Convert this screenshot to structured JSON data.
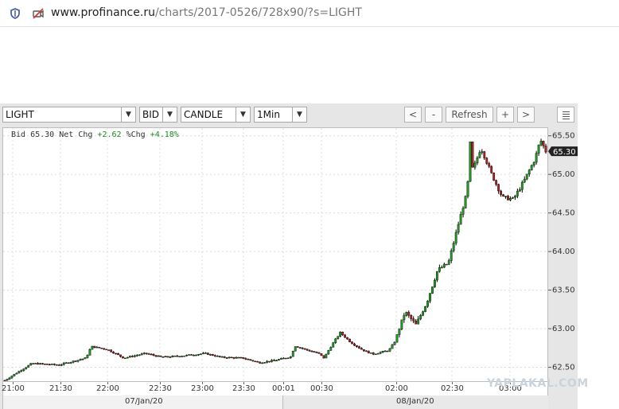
{
  "browser": {
    "url_domain": "www.profinance.ru",
    "url_path": "/charts/2017-0526/728x90/?s=LIGHT",
    "icons": [
      "shield-icon",
      "camera-blocked-icon"
    ]
  },
  "toolbar": {
    "symbol": "LIGHT",
    "price_type": "BID",
    "chart_style": "CANDLE",
    "interval": "1Min",
    "back_label": "<",
    "zoom_out_label": "-",
    "refresh_label": "Refresh",
    "zoom_in_label": "+",
    "forward_label": ">",
    "menu_icon": "list-icon"
  },
  "quote": {
    "bid_label": "Bid",
    "bid": "65.30",
    "net_chg_label": "Net Chg",
    "net_chg": "+2.62",
    "pct_chg_label": "%Chg",
    "pct_chg": "+4.18%"
  },
  "watermark": "YAPLAKAL.COM",
  "colors": {
    "up": "#1f9a1f",
    "down": "#b02020",
    "wick": "#000000",
    "grid": "#dcdcdc",
    "panel": "#e6e6e6"
  },
  "chart_data": {
    "type": "candlestick",
    "grid": true,
    "ylim": [
      62.32,
      65.6
    ],
    "y_ticks": [
      "62.50",
      "63.00",
      "63.50",
      "64.00",
      "64.50",
      "65.00",
      "65.50"
    ],
    "last_price_label": "65.30",
    "x_ticks": [
      "21:00",
      "21:30",
      "22:00",
      "22:30",
      "23:00",
      "23:30",
      "00:01",
      "00:30",
      "02:00",
      "02:30",
      "03:00"
    ],
    "dates": [
      "07/Jan/20",
      "08/Jan/20"
    ],
    "price_path": [
      [
        0,
        62.33
      ],
      [
        0.02,
        62.42
      ],
      [
        0.05,
        62.55
      ],
      [
        0.1,
        62.53
      ],
      [
        0.15,
        62.62
      ],
      [
        0.16,
        62.77
      ],
      [
        0.19,
        62.73
      ],
      [
        0.22,
        62.62
      ],
      [
        0.26,
        62.68
      ],
      [
        0.29,
        62.63
      ],
      [
        0.33,
        62.65
      ],
      [
        0.37,
        62.68
      ],
      [
        0.4,
        62.63
      ],
      [
        0.44,
        62.62
      ],
      [
        0.47,
        62.56
      ],
      [
        0.5,
        62.59
      ],
      [
        0.53,
        62.64
      ],
      [
        0.535,
        62.78
      ],
      [
        0.56,
        62.72
      ],
      [
        0.58,
        62.68
      ],
      [
        0.59,
        62.62
      ],
      [
        0.6,
        62.74
      ],
      [
        0.62,
        62.95
      ],
      [
        0.64,
        62.82
      ],
      [
        0.66,
        62.73
      ],
      [
        0.68,
        62.67
      ],
      [
        0.71,
        62.72
      ],
      [
        0.72,
        62.82
      ],
      [
        0.74,
        63.22
      ],
      [
        0.76,
        63.05
      ],
      [
        0.78,
        63.34
      ],
      [
        0.8,
        63.76
      ],
      [
        0.82,
        63.85
      ],
      [
        0.84,
        64.4
      ],
      [
        0.855,
        64.78
      ],
      [
        0.86,
        65.42
      ],
      [
        0.865,
        65.05
      ],
      [
        0.88,
        65.35
      ],
      [
        0.9,
        65.0
      ],
      [
        0.92,
        64.7
      ],
      [
        0.94,
        64.68
      ],
      [
        0.96,
        64.92
      ],
      [
        0.98,
        65.2
      ],
      [
        0.99,
        65.45
      ],
      [
        1.0,
        65.3
      ]
    ]
  }
}
